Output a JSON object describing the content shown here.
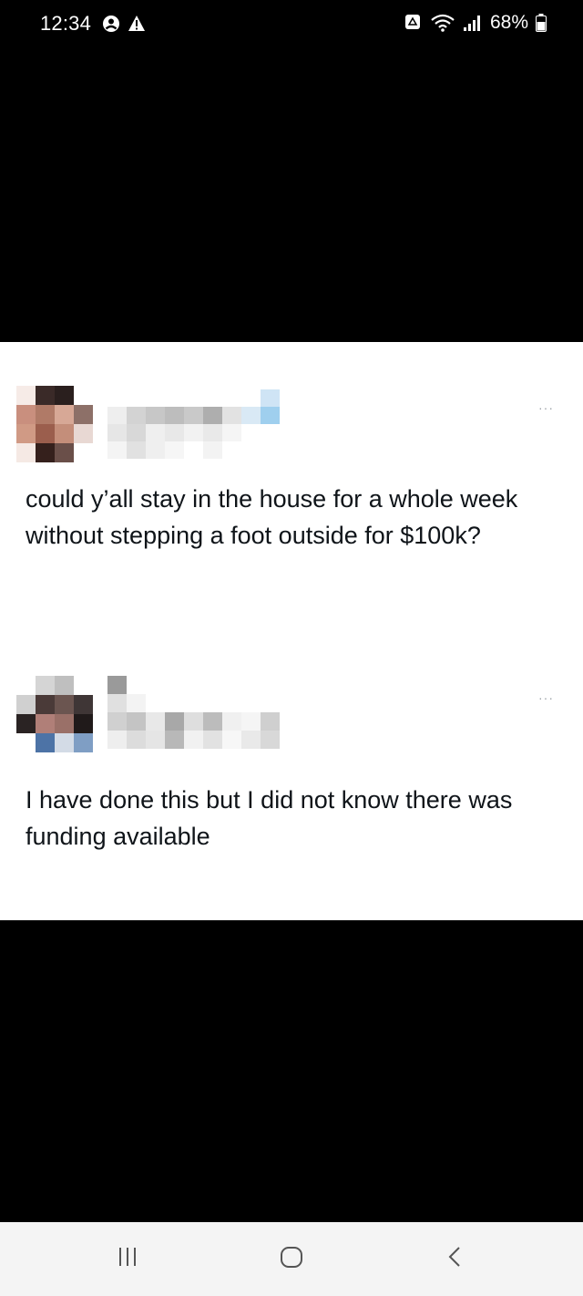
{
  "status_bar": {
    "time": "12:34",
    "battery": "68%",
    "icons": [
      "account-circle-icon",
      "warning-icon",
      "lock-notify-icon",
      "wifi-icon",
      "signal-icon",
      "battery-icon"
    ]
  },
  "posts": [
    {
      "text": "could y’all stay in the house for a whole week without stepping a foot outside for $100k?",
      "more_label": "···"
    },
    {
      "text": "I have done this but I did not know there was funding available",
      "more_label": "···"
    }
  ],
  "nav_bar": {
    "icons": [
      "recent-apps-icon",
      "home-icon",
      "back-icon"
    ]
  },
  "colors": {
    "background": "#000000",
    "card": "#ffffff",
    "text": "#0f1419",
    "muted": "#9aa0a6",
    "nav_bar": "#f4f4f4"
  }
}
